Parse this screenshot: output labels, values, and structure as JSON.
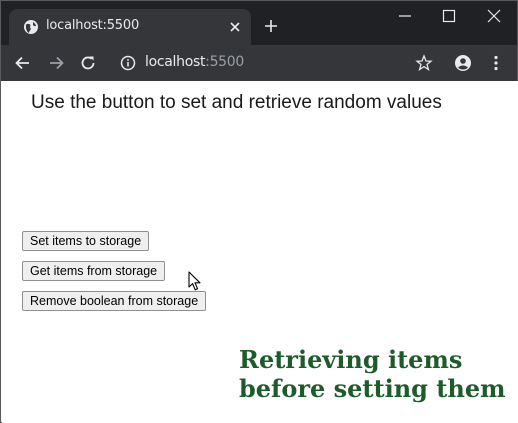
{
  "browser": {
    "tab_title": "localhost:5500",
    "url_host": "localhost",
    "url_port": ":5500"
  },
  "page": {
    "heading": "Use the button to set and retrieve random values",
    "buttons": [
      {
        "label": "Set items to storage"
      },
      {
        "label": "Get items from storage"
      },
      {
        "label": "Remove boolean from storage"
      }
    ],
    "caption_line1": "Retrieving items",
    "caption_line2": "before setting them"
  },
  "colors": {
    "titlebar": "#202124",
    "toolbar": "#35363a",
    "caption": "#1e5b2a"
  }
}
